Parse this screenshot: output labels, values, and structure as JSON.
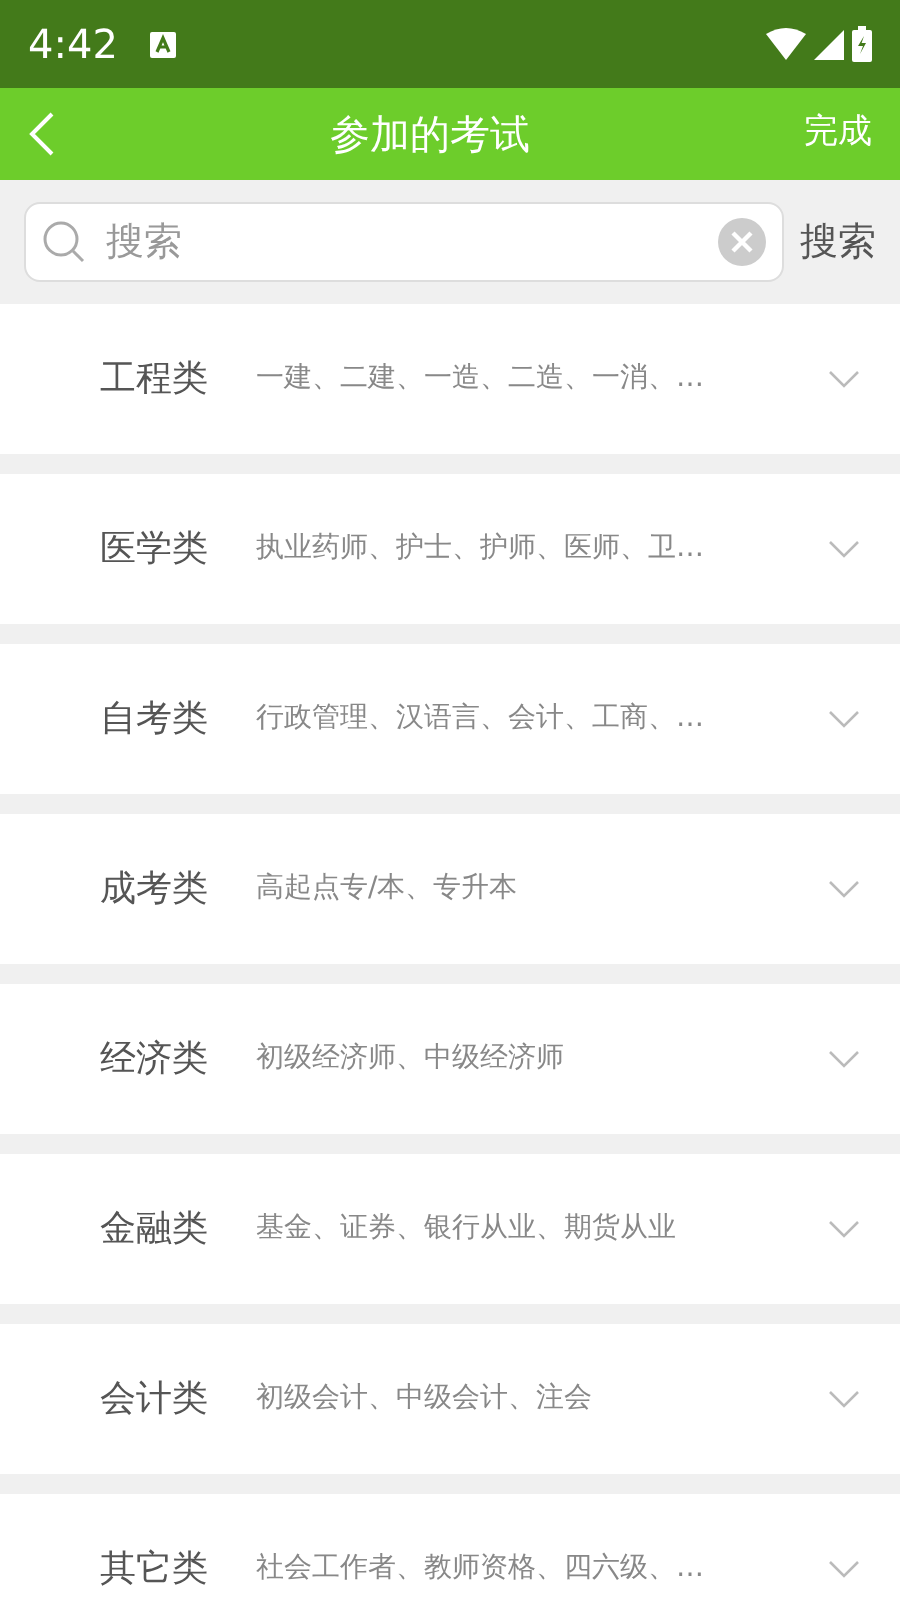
{
  "status_bar": {
    "time": "4:42"
  },
  "header": {
    "title": "参加的考试",
    "action": "完成"
  },
  "search": {
    "placeholder": "搜索",
    "button": "搜索"
  },
  "categories": [
    {
      "name": "工程类",
      "items": "一建、二建、一造、二造、一消、…",
      "expanded": false
    },
    {
      "name": "医学类",
      "items": "执业药师、护士、护师、医师、卫…",
      "expanded": false
    },
    {
      "name": "自考类",
      "items": "行政管理、汉语言、会计、工商、…",
      "expanded": false
    },
    {
      "name": "成考类",
      "items": "高起点专/本、专升本",
      "expanded": false
    },
    {
      "name": "经济类",
      "items": "初级经济师、中级经济师",
      "expanded": false
    },
    {
      "name": "金融类",
      "items": "基金、证券、银行从业、期货从业",
      "expanded": false
    },
    {
      "name": "会计类",
      "items": "初级会计、中级会计、注会",
      "expanded": false
    },
    {
      "name": "其它类",
      "items": "社会工作者、教师资格、四六级、…",
      "expanded": false
    }
  ]
}
